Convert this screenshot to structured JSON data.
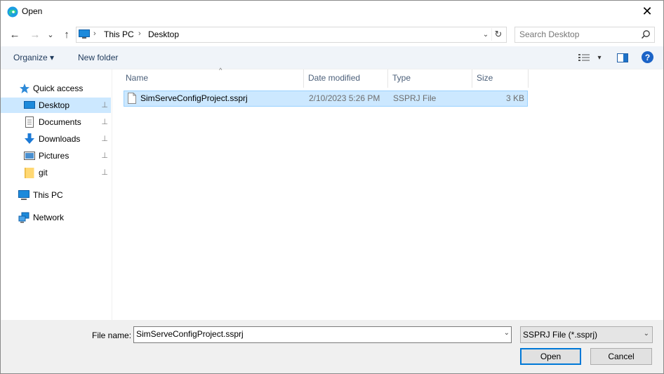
{
  "window": {
    "title": "Open",
    "close_glyph": "✕"
  },
  "nav": {
    "back_glyph": "←",
    "forward_glyph": "→",
    "recent_glyph": "⌄",
    "up_glyph": "↑",
    "breadcrumbs": [
      "This PC",
      "Desktop"
    ],
    "crumb_sep": "›",
    "dropdown_glyph": "⌄",
    "refresh_glyph": "↻"
  },
  "search": {
    "placeholder": "Search Desktop"
  },
  "commands": {
    "organize": "Organize ▾",
    "new_folder": "New folder",
    "view_dd": "▾",
    "help": "?"
  },
  "sidebar": {
    "items": [
      {
        "label": "Quick access",
        "icon": "star-icon"
      },
      {
        "label": "Desktop",
        "icon": "desktop-icon",
        "pinned": true,
        "selected": true
      },
      {
        "label": "Documents",
        "icon": "documents-icon",
        "pinned": true
      },
      {
        "label": "Downloads",
        "icon": "downloads-icon",
        "pinned": true
      },
      {
        "label": "Pictures",
        "icon": "pictures-icon",
        "pinned": true
      },
      {
        "label": "git",
        "icon": "folder-icon",
        "pinned": true
      },
      {
        "label": "This PC",
        "icon": "computer-icon"
      },
      {
        "label": "Network",
        "icon": "network-icon"
      }
    ],
    "pin_glyph": "📌"
  },
  "filelist": {
    "columns": [
      "Name",
      "Date modified",
      "Type",
      "Size"
    ],
    "sort_glyph": "^",
    "rows": [
      {
        "name": "SimServeConfigProject.ssprj",
        "date": "2/10/2023 5:26 PM",
        "type": "SSPRJ File",
        "size": "3 KB"
      }
    ]
  },
  "footer": {
    "file_name_label": "File name:",
    "file_name_value": "SimServeConfigProject.ssprj",
    "filter_value": "SSPRJ File (*.ssprj)",
    "open_label": "Open",
    "cancel_label": "Cancel",
    "dd_glyph": "⌄"
  },
  "colors": {
    "selection": "#cce8ff",
    "selection_border": "#99d1ff",
    "accent": "#0078d7"
  }
}
